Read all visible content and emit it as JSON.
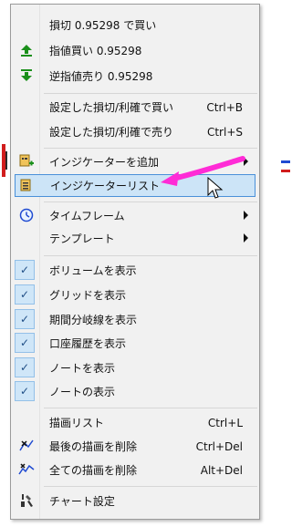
{
  "menu": {
    "items": [
      {
        "label": "損切 0.95298 で買い",
        "shortcut": "",
        "icon": "none",
        "submenu": false,
        "checked": false
      },
      {
        "label": "指値買い  0.95298",
        "shortcut": "",
        "icon": "buy-limit-icon",
        "submenu": false,
        "checked": false
      },
      {
        "label": "逆指値売り  0.95298",
        "shortcut": "",
        "icon": "sell-stop-icon",
        "submenu": false,
        "checked": false
      },
      {
        "label": "設定した損切/利確で買い",
        "shortcut": "Ctrl+B",
        "icon": "none",
        "submenu": false,
        "checked": false
      },
      {
        "label": "設定した損切/利確で売り",
        "shortcut": "Ctrl+S",
        "icon": "none",
        "submenu": false,
        "checked": false
      },
      {
        "label": "インジケーターを追加",
        "shortcut": "",
        "icon": "add-indicator-icon",
        "submenu": true,
        "checked": false
      },
      {
        "label": "インジケーターリスト",
        "shortcut": "",
        "icon": "indicator-list-icon",
        "submenu": false,
        "checked": false,
        "highlighted": true
      },
      {
        "label": "タイムフレーム",
        "shortcut": "",
        "icon": "clock-icon",
        "submenu": true,
        "checked": false
      },
      {
        "label": "テンプレート",
        "shortcut": "",
        "icon": "none",
        "submenu": true,
        "checked": false
      },
      {
        "label": "ボリュームを表示",
        "shortcut": "",
        "icon": "check-icon",
        "submenu": false,
        "checked": true
      },
      {
        "label": "グリッドを表示",
        "shortcut": "",
        "icon": "check-icon",
        "submenu": false,
        "checked": true
      },
      {
        "label": "期間分岐線を表示",
        "shortcut": "",
        "icon": "check-icon",
        "submenu": false,
        "checked": true
      },
      {
        "label": "口座履歴を表示",
        "shortcut": "",
        "icon": "check-icon",
        "submenu": false,
        "checked": true
      },
      {
        "label": "ノートを表示",
        "shortcut": "",
        "icon": "check-icon",
        "submenu": false,
        "checked": true
      },
      {
        "label": "ノートの表示",
        "shortcut": "",
        "icon": "check-icon",
        "submenu": false,
        "checked": true
      },
      {
        "label": "描画リスト",
        "shortcut": "Ctrl+L",
        "icon": "none",
        "submenu": false,
        "checked": false
      },
      {
        "label": "最後の描画を削除",
        "shortcut": "Ctrl+Del",
        "icon": "delete-last-drawing-icon",
        "submenu": false,
        "checked": false
      },
      {
        "label": "全ての描画を削除",
        "shortcut": "Alt+Del",
        "icon": "delete-all-drawings-icon",
        "submenu": false,
        "checked": false
      },
      {
        "label": "チャート設定",
        "shortcut": "",
        "icon": "tools-icon",
        "submenu": false,
        "checked": false
      }
    ]
  },
  "colors": {
    "menu_bg": "#f1f1f1",
    "highlight_bg": "#cce4f7",
    "highlight_border": "#4a90d9",
    "check_bg": "#cfe6f8",
    "annotation_arrow": "#ff2bd6"
  }
}
